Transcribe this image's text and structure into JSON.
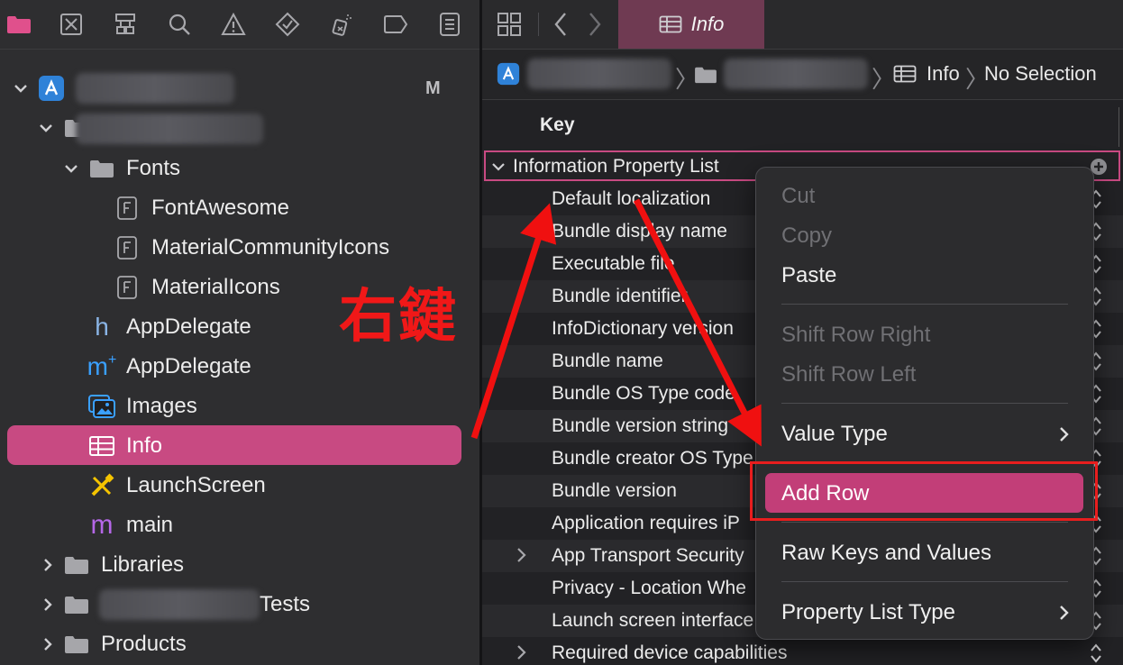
{
  "navigator": {
    "project": {
      "badge": "M"
    },
    "rows": {
      "fonts": "Fonts",
      "font_awesome": "FontAwesome",
      "material_community_icons": "MaterialCommunityIcons",
      "material_icons": "MaterialIcons",
      "app_delegate_h": "AppDelegate",
      "app_delegate_m": "AppDelegate",
      "images": "Images",
      "info": "Info",
      "launch_screen": "LaunchScreen",
      "main": "main",
      "libraries": "Libraries",
      "tests_suffix": "Tests",
      "products": "Products"
    },
    "file_type_letter": "F",
    "h_letter": "h",
    "m_letter": "m",
    "mplus_letter": "m"
  },
  "annotation": {
    "text": "右鍵"
  },
  "editor": {
    "tab": {
      "label": "Info"
    },
    "jump_bar": {
      "file": "Info",
      "selection": "No Selection"
    },
    "column_header": "Key",
    "root": "Information Property List",
    "rows": [
      "Default localization",
      "Bundle display name",
      "Executable file",
      "Bundle identifier",
      "InfoDictionary version",
      "Bundle name",
      "Bundle OS Type code",
      "Bundle version string",
      "Bundle creator OS Type",
      "Bundle version",
      "Application requires iP",
      "App Transport Security",
      "Privacy - Location Whe",
      "Launch screen interface",
      "Required device capabilities"
    ]
  },
  "context_menu": {
    "cut": "Cut",
    "copy": "Copy",
    "paste": "Paste",
    "shift_right": "Shift Row Right",
    "shift_left": "Shift Row Left",
    "value_type": "Value Type",
    "add_row": "Add Row",
    "raw_keys": "Raw Keys and Values",
    "plist_type": "Property List Type"
  },
  "colors": {
    "selection": "#c84a82",
    "tab_active": "#6f3a52",
    "annotation_red": "#f01818",
    "folder_pink": "#e0508c"
  }
}
